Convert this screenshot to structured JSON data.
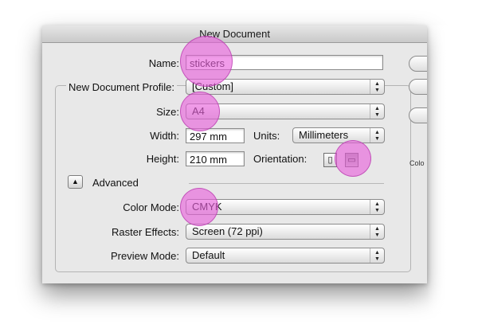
{
  "dialog": {
    "title": "New Document"
  },
  "form": {
    "name_label": "Name:",
    "name_value": "stickers",
    "profile_label": "New Document Profile:",
    "profile_value": "[Custom]",
    "size_label": "Size:",
    "size_value": "A4",
    "width_label": "Width:",
    "width_value": "297 mm",
    "units_label": "Units:",
    "units_value": "Millimeters",
    "height_label": "Height:",
    "height_value": "210 mm",
    "orientation_label": "Orientation:",
    "advanced_label": "Advanced",
    "color_mode_label": "Color Mode:",
    "color_mode_value": "CMYK",
    "raster_label": "Raster Effects:",
    "raster_value": "Screen (72 ppi)",
    "preview_label": "Preview Mode:",
    "preview_value": "Default"
  },
  "side": {
    "partial_label": "Colo"
  },
  "icons": {
    "popup_arrows": "updown-arrows-icon",
    "disclosure": "triangle-up-icon",
    "portrait": "portrait-icon",
    "landscape": "landscape-icon"
  },
  "colors": {
    "highlight": "#e85fdc",
    "dialog_bg": "#e8e8e8"
  }
}
